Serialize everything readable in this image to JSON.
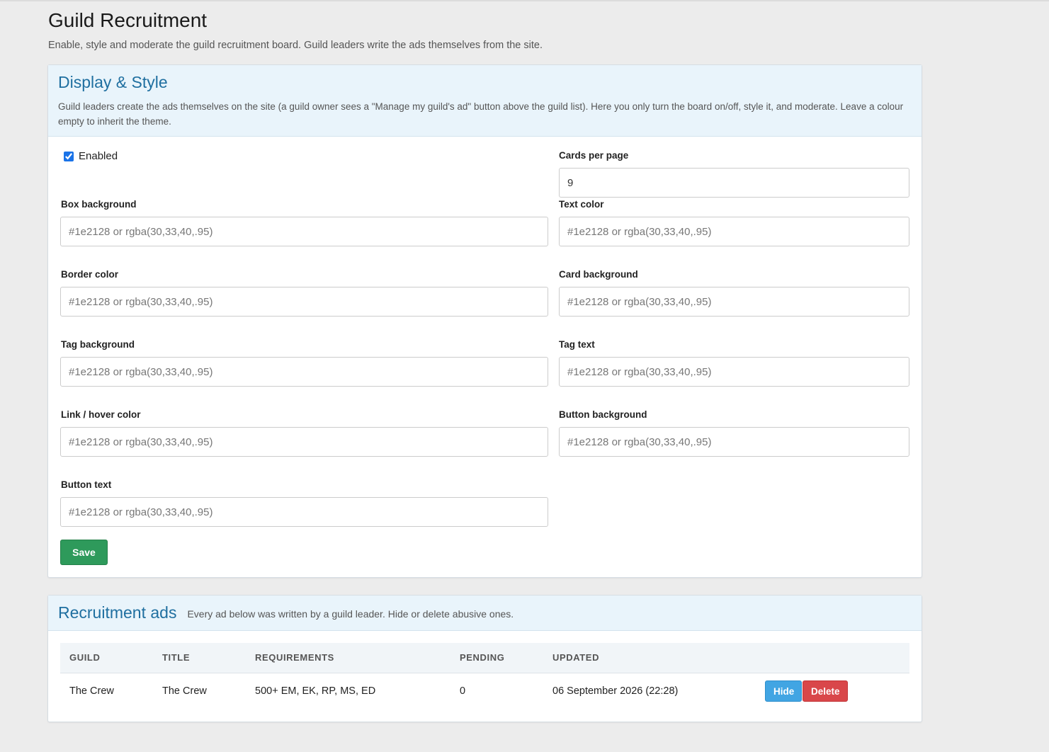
{
  "header": {
    "title": "Guild Recruitment",
    "subtitle": "Enable, style and moderate the guild recruitment board. Guild leaders write the ads themselves from the site."
  },
  "display": {
    "title": "Display & Style",
    "description": "Guild leaders create the ads themselves on the site (a guild owner sees a \"Manage my guild's ad\" button above the guild list). Here you only turn the board on/off, style it, and moderate. Leave a colour empty to inherit the theme.",
    "enabled_label": "Enabled",
    "enabled_checked": true,
    "cards_per_page_label": "Cards per page",
    "cards_per_page_value": "9",
    "color_placeholder": "#1e2128 or rgba(30,33,40,.95)",
    "fields": {
      "box_background": "Box background",
      "text_color": "Text color",
      "border_color": "Border color",
      "card_background": "Card background",
      "tag_background": "Tag background",
      "tag_text": "Tag text",
      "link_hover_color": "Link / hover color",
      "button_background": "Button background",
      "button_text": "Button text"
    },
    "save_label": "Save"
  },
  "ads": {
    "title": "Recruitment ads",
    "subtitle": "Every ad below was written by a guild leader. Hide or delete abusive ones.",
    "columns": [
      "GUILD",
      "TITLE",
      "REQUIREMENTS",
      "PENDING",
      "UPDATED"
    ],
    "rows": [
      {
        "guild": "The Crew",
        "title": "The Crew",
        "requirements": "500+ EM, EK, RP, MS, ED",
        "pending": "0",
        "updated": "06 September 2026 (22:28)"
      }
    ],
    "hide_label": "Hide",
    "delete_label": "Delete"
  },
  "colors": {
    "page_bg": "#ececec",
    "card_head_bg": "#e9f4fb",
    "title_blue": "#1f6fa0",
    "save_green": "#2e9a5b",
    "hide_blue": "#41a5e3",
    "delete_red": "#d9474a"
  }
}
